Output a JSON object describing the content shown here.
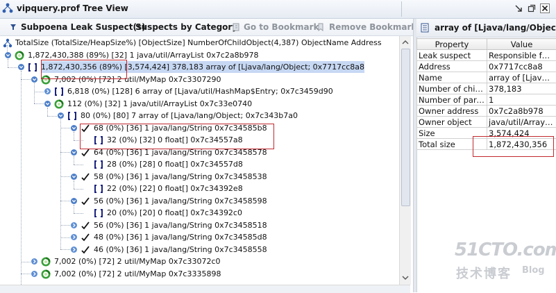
{
  "window": {
    "title": "vipquery.prof Tree View",
    "icons": [
      "tree-view-icon",
      "minimize-to-tray-icon",
      "restore-icon",
      "close-icon"
    ]
  },
  "toolbar": {
    "items": [
      {
        "label": "Subpoena Leak Suspect(s)",
        "icon": "filter-icon",
        "enabled": true
      },
      {
        "label": "Suspects by Category",
        "icon": "",
        "enabled": true
      },
      {
        "label": "Go to Bookmark",
        "icon": "goto-bookmark-icon",
        "enabled": false
      },
      {
        "label": "Remove Bookmark",
        "icon": "remove-bookmark-icon",
        "enabled": false
      }
    ]
  },
  "tree": {
    "header": "TotalSize (TotalSize/HeapSize%) [ObjectSize] NumberOfChildObject(4,387) ObjectName Address",
    "rows": [
      {
        "depth": 0,
        "icon": "object-icon",
        "expander": "expanded",
        "text": "1,872,430,388 (89%) [32] 1 java/util/ArrayList 0x7c2a8b978",
        "selected": false
      },
      {
        "depth": 1,
        "icon": "array-icon",
        "expander": "expanded",
        "text": "1,872,430,356 (89%) [3,574,424] 378,183 array of [Ljava/lang/Object; 0x7717cc8a8",
        "selected": true
      },
      {
        "depth": 2,
        "icon": "object-icon",
        "expander": "expanded",
        "text": "7,002 (0%) [72] 2 util/MyMap 0x7c3307290",
        "selected": false
      },
      {
        "depth": 3,
        "icon": "array-icon",
        "expander": "collapsed",
        "text": "6,818 (0%) [128] 6 array of [Ljava/util/HashMap$Entry; 0x7c3459d90",
        "selected": false
      },
      {
        "depth": 3,
        "icon": "object-icon",
        "expander": "expanded",
        "text": "112 (0%) [32] 1 java/util/ArrayList 0x7c33e0740",
        "selected": false
      },
      {
        "depth": 4,
        "icon": "array-icon",
        "expander": "expanded",
        "text": "80 (0%) [80] 7 array of [Ljava/lang/Object; 0x7c343b7a0",
        "selected": false
      },
      {
        "depth": 5,
        "icon": "check-icon",
        "expander": "expanded",
        "text": "68 (0%) [36] 1 java/lang/String 0x7c34585b8",
        "selected": false
      },
      {
        "depth": 6,
        "icon": "array-icon",
        "expander": "none",
        "text": "32 (0%) [32] 0 float[] 0x7c34557a8",
        "selected": false
      },
      {
        "depth": 5,
        "icon": "check-icon",
        "expander": "expanded",
        "text": "64 (0%) [36] 1 java/lang/String 0x7c3458578",
        "selected": false
      },
      {
        "depth": 6,
        "icon": "array-icon",
        "expander": "none",
        "text": "28 (0%) [28] 0 float[] 0x7c34557d8",
        "selected": false
      },
      {
        "depth": 5,
        "icon": "check-icon",
        "expander": "expanded",
        "text": "58 (0%) [36] 1 java/lang/String 0x7c3458538",
        "selected": false
      },
      {
        "depth": 6,
        "icon": "array-icon",
        "expander": "none",
        "text": "22 (0%) [22] 0 float[] 0x7c34392e8",
        "selected": false
      },
      {
        "depth": 5,
        "icon": "check-icon",
        "expander": "expanded",
        "text": "56 (0%) [36] 1 java/lang/String 0x7c3458598",
        "selected": false
      },
      {
        "depth": 6,
        "icon": "array-icon",
        "expander": "none",
        "text": "20 (0%) [20] 0 float[] 0x7c34392c0",
        "selected": false
      },
      {
        "depth": 5,
        "icon": "check-icon",
        "expander": "collapsed",
        "text": "56 (0%) [36] 1 java/lang/String 0x7c3458518",
        "selected": false
      },
      {
        "depth": 5,
        "icon": "check-icon",
        "expander": "collapsed",
        "text": "48 (0%) [36] 1 java/lang/String 0x7c34585d8",
        "selected": false
      },
      {
        "depth": 5,
        "icon": "check-icon",
        "expander": "collapsed",
        "text": "46 (0%) [36] 1 java/lang/String 0x7c3458558",
        "selected": false
      },
      {
        "depth": 2,
        "icon": "object-icon",
        "expander": "collapsed",
        "text": "7,002 (0%) [72] 2 util/MyMap 0x7c33072c0",
        "selected": false
      },
      {
        "depth": 2,
        "icon": "object-icon",
        "expander": "collapsed",
        "text": "7,002 (0%) [72] 2 util/MyMap 0x7c3335898",
        "selected": false
      }
    ]
  },
  "properties": {
    "title": "array of [Ljava/lang/Object; a...",
    "icon": "properties-icon",
    "columns": [
      "Property",
      "Value"
    ],
    "rows": [
      {
        "property": "Leak suspect",
        "value": "Responsible for..."
      },
      {
        "property": "Address",
        "value": "0x7717cc8a8"
      },
      {
        "property": "Name",
        "value": "array of [Ljava/la..."
      },
      {
        "property": "Number of child...",
        "value": "378,183"
      },
      {
        "property": "Number of pare...",
        "value": "1"
      },
      {
        "property": "Owner address",
        "value": "0x7c2a8b978"
      },
      {
        "property": "Owner object",
        "value": "java/util/ArrayList"
      },
      {
        "property": "Size",
        "value": "3,574,424"
      },
      {
        "property": "Total size",
        "value": "1,872,430,356"
      }
    ]
  },
  "watermark": {
    "brand": "51CTO.com",
    "subtitle": "技术博客",
    "blog": "Blog"
  },
  "colors": {
    "selection": "#c7d8f3",
    "highlight_box": "#c0282e",
    "object_icon": "#3aa03a",
    "array_icon": "#1a237e"
  }
}
